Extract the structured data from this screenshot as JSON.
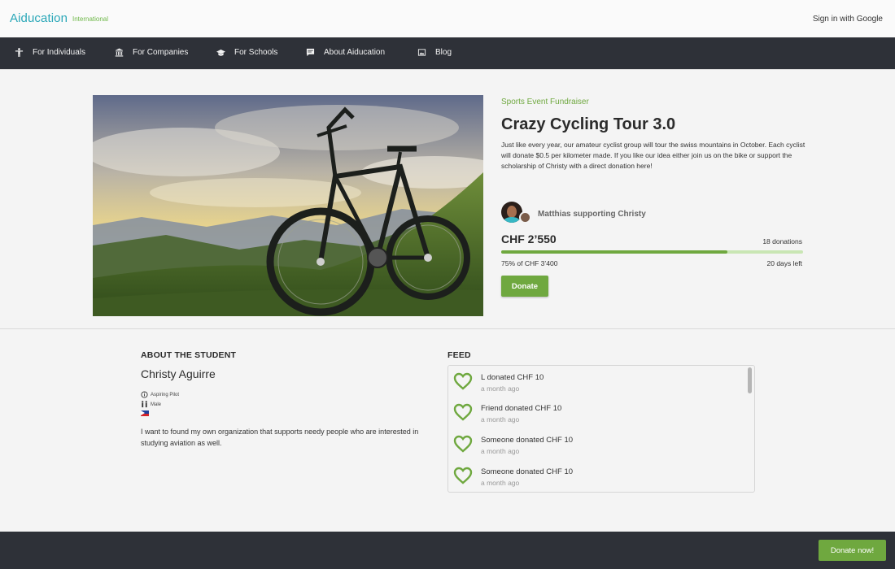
{
  "header": {
    "brand": "Aiducation",
    "brand_sub": "International",
    "signin": "Sign in with Google"
  },
  "nav": {
    "items": [
      {
        "label": "For Individuals",
        "icon": "person-icon"
      },
      {
        "label": "For Companies",
        "icon": "building-icon"
      },
      {
        "label": "For Schools",
        "icon": "graduation-cap-icon"
      },
      {
        "label": "About Aiducation",
        "icon": "chat-icon"
      },
      {
        "label": "Blog",
        "icon": "image-icon"
      }
    ]
  },
  "campaign": {
    "hero_image": "mountain-bike-on-hillside",
    "category": "Sports Event Fundraiser",
    "title": "Crazy Cycling Tour 3.0",
    "description": "Just like every year, our amateur cyclist group will tour the swiss mountains in October. Each cyclist will donate $0.5 per kilometer made. If you like our idea either join us on the bike or support the scholarship of Christy with a direct donation here!",
    "supporter": "Matthias supporting Christy",
    "amount": "CHF 2’550",
    "donations": "18 donations",
    "progress_percent": 75,
    "goal": "75% of CHF 3’400",
    "days_left": "20 days left",
    "donate_label": "Donate"
  },
  "about": {
    "heading": "ABOUT THE STUDENT",
    "name": "Christy Aguirre",
    "occupation": "Aspiring Pilot",
    "gender": "Male",
    "country_flag": "philippines-flag",
    "bio": "I want to found my own organization that supports needy people who are interested in studying aviation as well."
  },
  "feed": {
    "heading": "FEED",
    "items": [
      {
        "title": "L donated CHF 10",
        "time": "a month ago"
      },
      {
        "title": "Friend donated CHF 10",
        "time": "a month ago"
      },
      {
        "title": "Someone donated CHF 10",
        "time": "a month ago"
      },
      {
        "title": "Someone donated CHF 10",
        "time": "a month ago"
      }
    ]
  },
  "footer": {
    "donate_now": "Donate now!"
  },
  "colors": {
    "accent_green": "#6fa83f",
    "brand_teal": "#2aa7b8",
    "dark_bar": "#2e3138"
  }
}
